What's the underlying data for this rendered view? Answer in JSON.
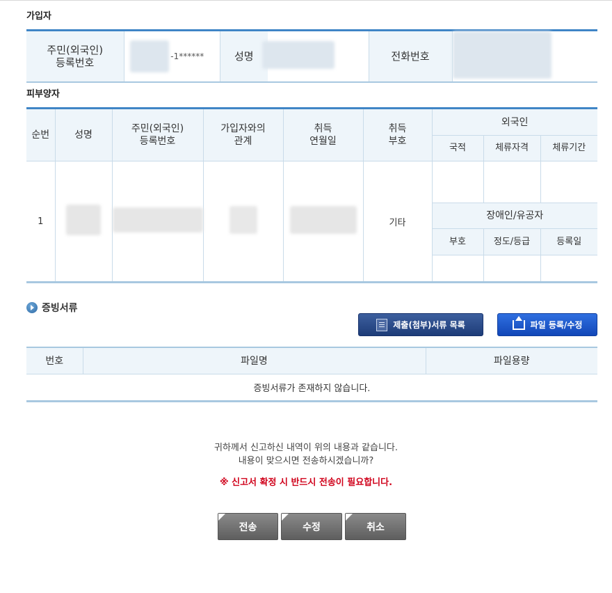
{
  "subscriber": {
    "title": "가입자",
    "rrn_label_1": "주민(외국인)",
    "rrn_label_2": "등록번호",
    "rrn_suffix": "-1******",
    "name_label": "성명",
    "phone_label": "전화번호"
  },
  "dependents": {
    "title": "피부양자",
    "headers": {
      "seq": "순번",
      "name": "성명",
      "rrn_1": "주민(외국인)",
      "rrn_2": "등록번호",
      "relation_1": "가입자와의",
      "relation_2": "관계",
      "acq_date_1": "취득",
      "acq_date_2": "연월일",
      "acq_code_1": "취득",
      "acq_code_2": "부호",
      "foreigner": "외국인",
      "nationality": "국적",
      "stay_status": "체류자격",
      "stay_period": "체류기간",
      "disability": "장애인/유공자",
      "code": "부호",
      "grade": "정도/등급",
      "reg_date": "등록일"
    },
    "rows": [
      {
        "seq": "1",
        "acq_code": "기타"
      }
    ]
  },
  "evidence": {
    "title": "증빙서류",
    "list_button": "제출(첨부)서류 목록",
    "file_button": "파일 등록/수정",
    "headers": {
      "no": "번호",
      "filename": "파일명",
      "size": "파일용량"
    },
    "empty": "증빙서류가 존재하지 않습니다."
  },
  "confirm": {
    "line1": "귀하께서 신고하신 내역이 위의 내용과 같습니다.",
    "line2": "내용이 맞으시면 전송하시겠습니까?",
    "warning": "※ 신고서 확정 시 반드시 전송이 필요합니다."
  },
  "actions": {
    "send": "전송",
    "edit": "수정",
    "cancel": "취소"
  },
  "colors": {
    "accent": "#3f85c6",
    "header_bg": "#eef5fa",
    "warning": "#d0021b"
  }
}
